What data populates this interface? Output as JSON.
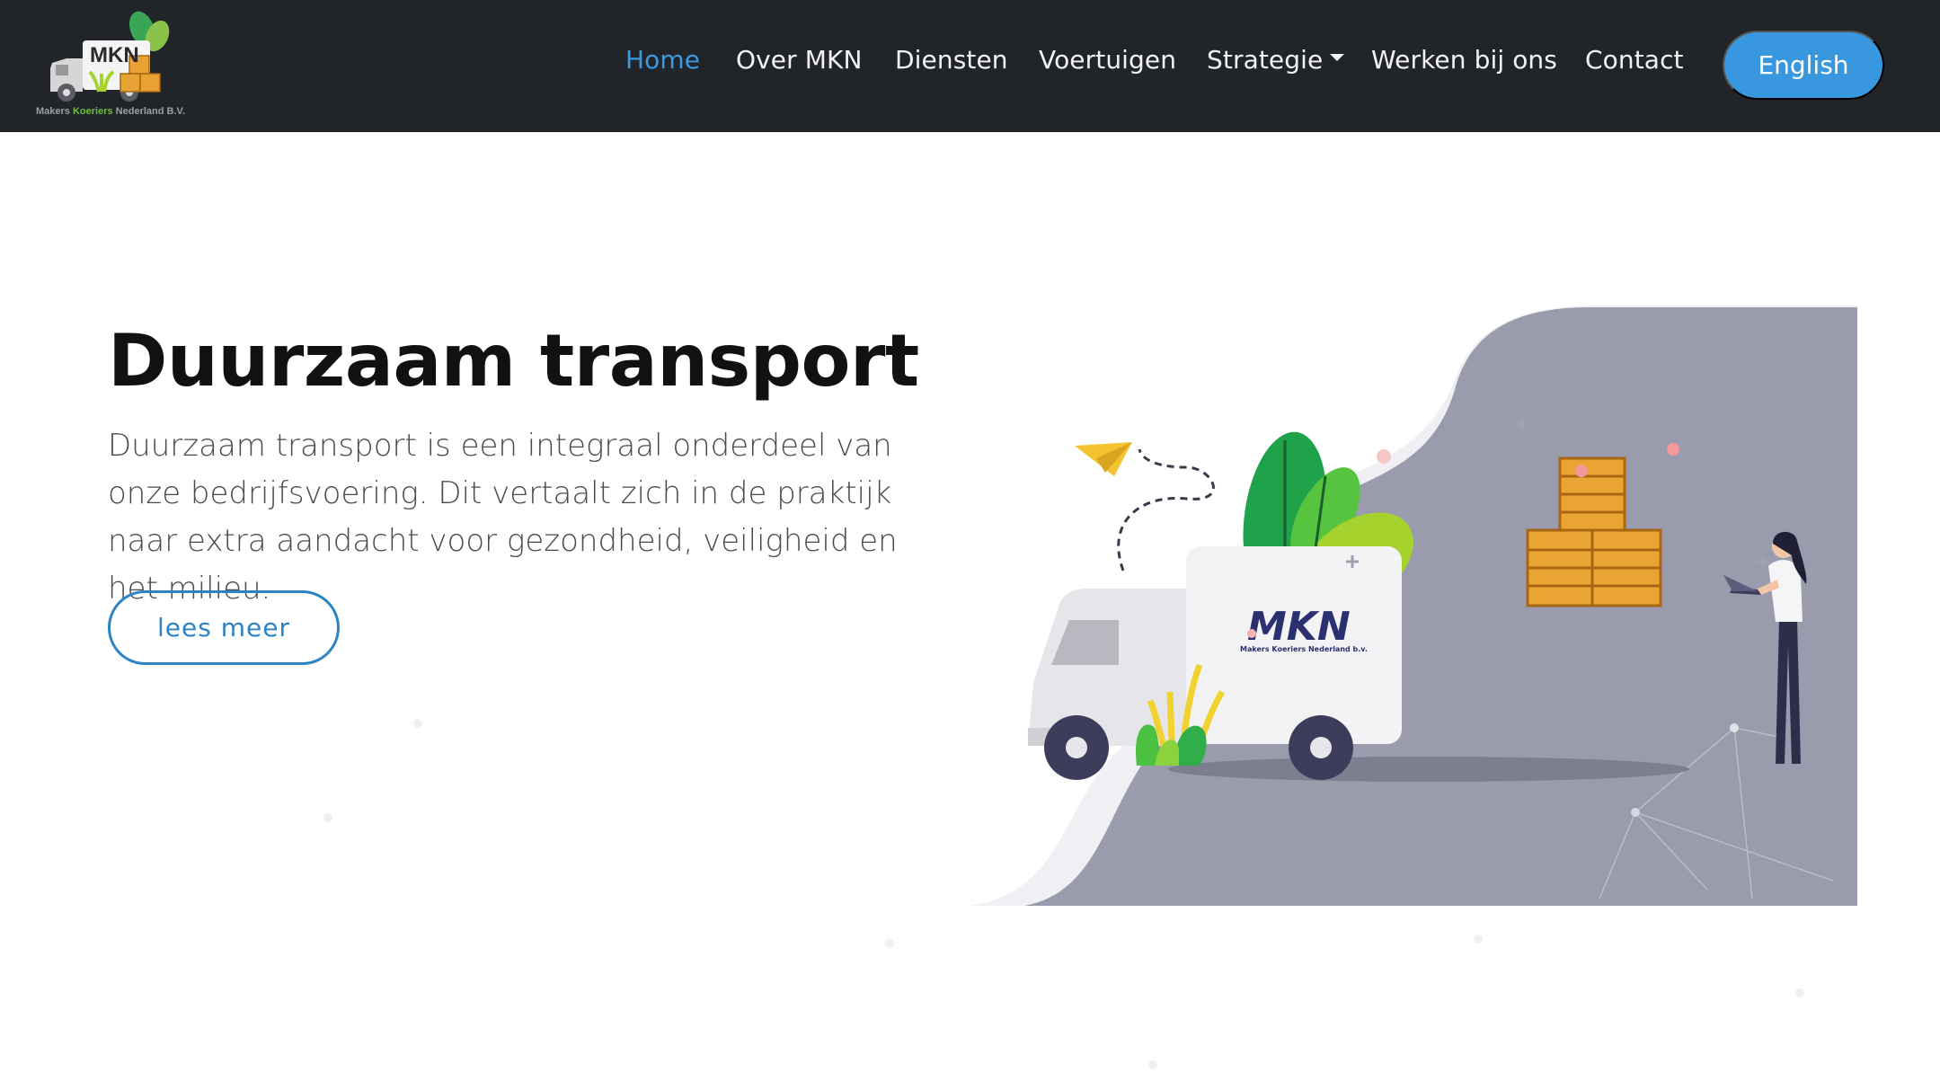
{
  "brand": {
    "logo_text": "MKN",
    "caption_part1": "Makers ",
    "caption_part2": "Koeriers",
    "caption_part3": " Nederland B.V."
  },
  "nav": {
    "items": [
      {
        "label": "Home",
        "active": true
      },
      {
        "label": "Over MKN"
      },
      {
        "label": "Diensten"
      },
      {
        "label": "Voertuigen"
      },
      {
        "label": "Strategie"
      },
      {
        "label": "Werken bij ons"
      },
      {
        "label": "Contact"
      }
    ],
    "language_button": "English"
  },
  "hero": {
    "title": "Duurzaam transport",
    "text": "Duurzaam transport is een integraal onderdeel van onze bedrijfsvoering. Dit vertaalt zich in de praktijk naar extra aandacht voor gezondheid, veiligheid en het milieu.",
    "cta_label": "lees meer"
  },
  "illustration": {
    "truck_logo": "MKN",
    "truck_caption": "Makers Koeriers Nederland b.v."
  },
  "colors": {
    "header_bg": "#212529",
    "accent": "#3897de",
    "nav_active": "#3a9ae0",
    "blob": "#9a9cad",
    "crate": "#e8a234"
  }
}
